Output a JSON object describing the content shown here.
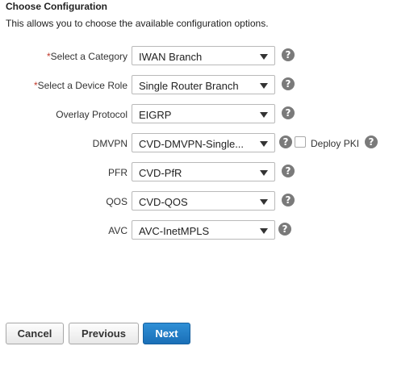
{
  "header": {
    "title": "Choose Configuration",
    "description": "This allows you to choose the available configuration options."
  },
  "fields": [
    {
      "required_mark": "*",
      "label": "Select a Category",
      "value": "IWAN Branch"
    },
    {
      "required_mark": "*",
      "label": "Select a Device Role",
      "value": "Single Router Branch"
    },
    {
      "required_mark": "",
      "label": "Overlay Protocol",
      "value": "EIGRP"
    },
    {
      "required_mark": "",
      "label": "DMVPN",
      "value": "CVD-DMVPN-Single..."
    },
    {
      "required_mark": "",
      "label": "PFR",
      "value": "CVD-PfR"
    },
    {
      "required_mark": "",
      "label": "QOS",
      "value": "CVD-QOS"
    },
    {
      "required_mark": "",
      "label": "AVC",
      "value": "AVC-InetMPLS"
    }
  ],
  "deploy_pki": {
    "label": "Deploy PKI",
    "checked": false
  },
  "help_glyph": "?",
  "buttons": {
    "cancel": "Cancel",
    "previous": "Previous",
    "next": "Next"
  },
  "icons": {
    "help": "question-circle-icon",
    "dropdown": "caret-down-icon"
  },
  "colors": {
    "primary_button": "#1a73c0",
    "required_mark": "#c0392b",
    "help_icon": "#7a7a7a"
  }
}
